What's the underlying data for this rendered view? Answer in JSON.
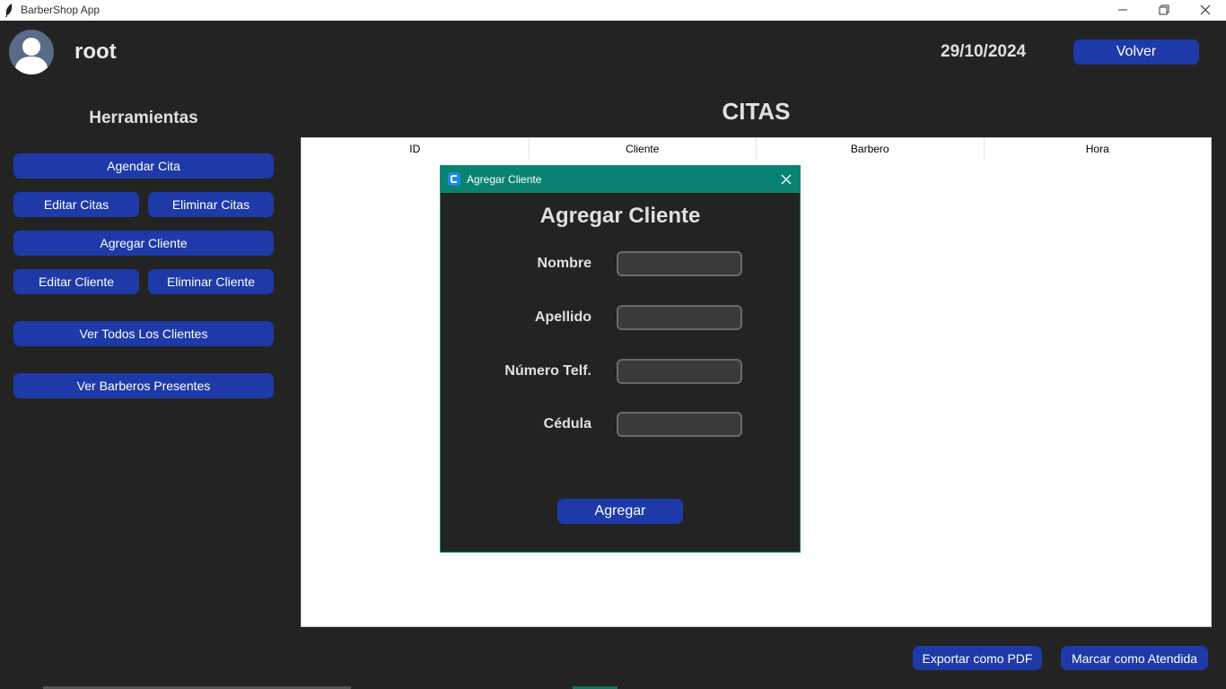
{
  "window": {
    "title": "BarberShop App",
    "controls": [
      "minimize-icon",
      "restore-icon",
      "close-icon"
    ]
  },
  "header": {
    "username": "root",
    "date": "29/10/2024",
    "back_label": "Volver"
  },
  "sidebar": {
    "title": "Herramientas",
    "buttons": {
      "agendar_cita": "Agendar Cita",
      "editar_citas": "Editar Citas",
      "eliminar_citas": "Eliminar Citas",
      "agregar_cliente": "Agregar Cliente",
      "editar_cliente": "Editar Cliente",
      "eliminar_cliente": "Eliminar Cliente",
      "ver_clientes": "Ver Todos Los Clientes",
      "ver_barberos": "Ver Barberos Presentes"
    }
  },
  "main": {
    "title": "CITAS",
    "table": {
      "columns": [
        "ID",
        "Cliente",
        "Barbero",
        "Hora"
      ],
      "rows": []
    }
  },
  "footer": {
    "export_pdf": "Exportar como PDF",
    "mark_attended": "Marcar como Atendida"
  },
  "dialog": {
    "window_title": "Agregar Cliente",
    "heading": "Agregar Cliente",
    "fields": {
      "nombre": {
        "label": "Nombre",
        "value": ""
      },
      "apellido": {
        "label": "Apellido",
        "value": ""
      },
      "telefono": {
        "label": "Número Telf.",
        "value": ""
      },
      "cedula": {
        "label": "Cédula",
        "value": ""
      }
    },
    "submit_label": "Agregar"
  },
  "colors": {
    "background": "#232323",
    "button": "#1d3aa8",
    "dialog_titlebar": "#0a8272",
    "table_background": "#ffffff"
  }
}
